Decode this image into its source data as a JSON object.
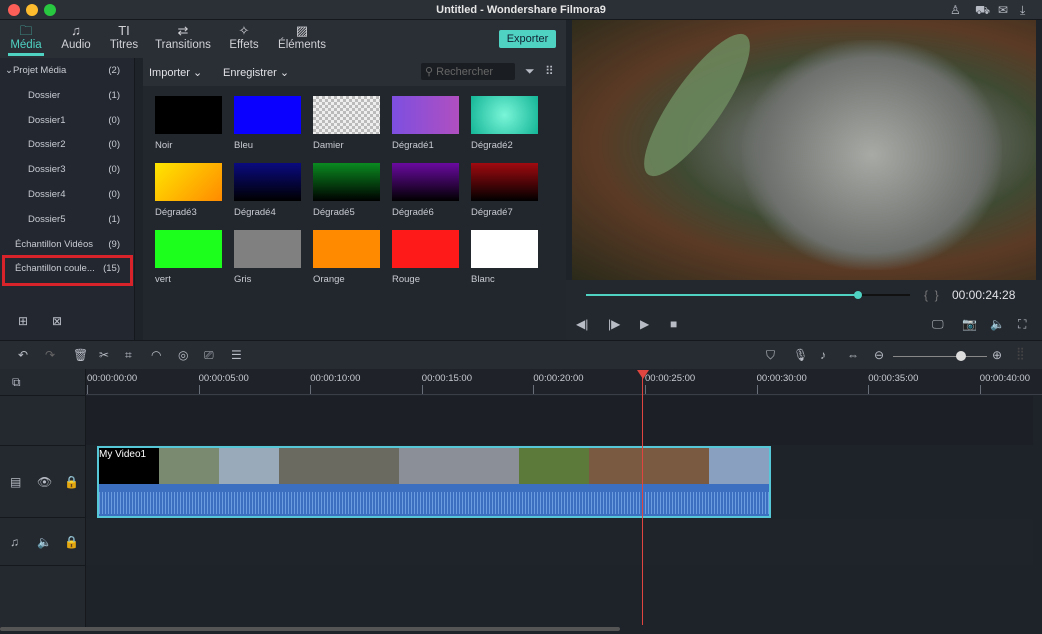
{
  "window": {
    "title": "Untitled - Wondershare Filmora9"
  },
  "tabs": [
    {
      "label": "Média",
      "icon": "folder-icon"
    },
    {
      "label": "Audio",
      "icon": "music-note-icon"
    },
    {
      "label": "Titres",
      "icon": "text-icon"
    },
    {
      "label": "Transitions",
      "icon": "transition-icon"
    },
    {
      "label": "Effets",
      "icon": "effects-icon"
    },
    {
      "label": "Éléments",
      "icon": "image-icon"
    }
  ],
  "export_label": "Exporter",
  "sidebar": [
    {
      "label": "Projet Média",
      "count": "(2)"
    },
    {
      "label": "Dossier",
      "count": "(1)"
    },
    {
      "label": "Dossier1",
      "count": "(0)"
    },
    {
      "label": "Dossier2",
      "count": "(0)"
    },
    {
      "label": "Dossier3",
      "count": "(0)"
    },
    {
      "label": "Dossier4",
      "count": "(0)"
    },
    {
      "label": "Dossier5",
      "count": "(1)"
    },
    {
      "label": "Échantillon Vidéos",
      "count": "(9)"
    },
    {
      "label": "Échantillon coule...",
      "count": "(15)"
    }
  ],
  "media_toolbar": {
    "import": "Importer",
    "record": "Enregistrer",
    "search_placeholder": "Rechercher"
  },
  "swatches": [
    {
      "label": "Noir",
      "color": "#000000"
    },
    {
      "label": "Bleu",
      "color": "#0a00ff"
    },
    {
      "label": "Damier",
      "color": "checker"
    },
    {
      "label": "Dégradé1",
      "color": "linear-gradient(90deg,#7d4fe0,#b04fc0)"
    },
    {
      "label": "Dégradé2",
      "color": "radial-gradient(circle,#7af5d8,#14b597)"
    },
    {
      "label": "Dégradé3",
      "color": "linear-gradient(135deg,#ffe600,#ff8a00)"
    },
    {
      "label": "Dégradé4",
      "color": "linear-gradient(180deg,#0a0a80,#000)"
    },
    {
      "label": "Dégradé5",
      "color": "linear-gradient(180deg,#0a8a20,#000)"
    },
    {
      "label": "Dégradé6",
      "color": "linear-gradient(180deg,#6a0aa0,#000)"
    },
    {
      "label": "Dégradé7",
      "color": "linear-gradient(180deg,#a00a10,#000)"
    },
    {
      "label": "vert",
      "color": "#1cff1c"
    },
    {
      "label": "Gris",
      "color": "#808080"
    },
    {
      "label": "Orange",
      "color": "#ff8a00"
    },
    {
      "label": "Rouge",
      "color": "#ff1a1a"
    },
    {
      "label": "Blanc",
      "color": "#ffffff"
    }
  ],
  "player": {
    "timecode": "00:00:24:28",
    "progress": 0.84
  },
  "ruler": [
    "00:00:00:00",
    "00:00:05:00",
    "00:00:10:00",
    "00:00:15:00",
    "00:00:20:00",
    "00:00:25:00",
    "00:00:30:00",
    "00:00:35:00",
    "00:00:40:00"
  ],
  "clip": {
    "name": "My Video1"
  },
  "zoom_level": 0.72,
  "accent": "#4fd2c2"
}
